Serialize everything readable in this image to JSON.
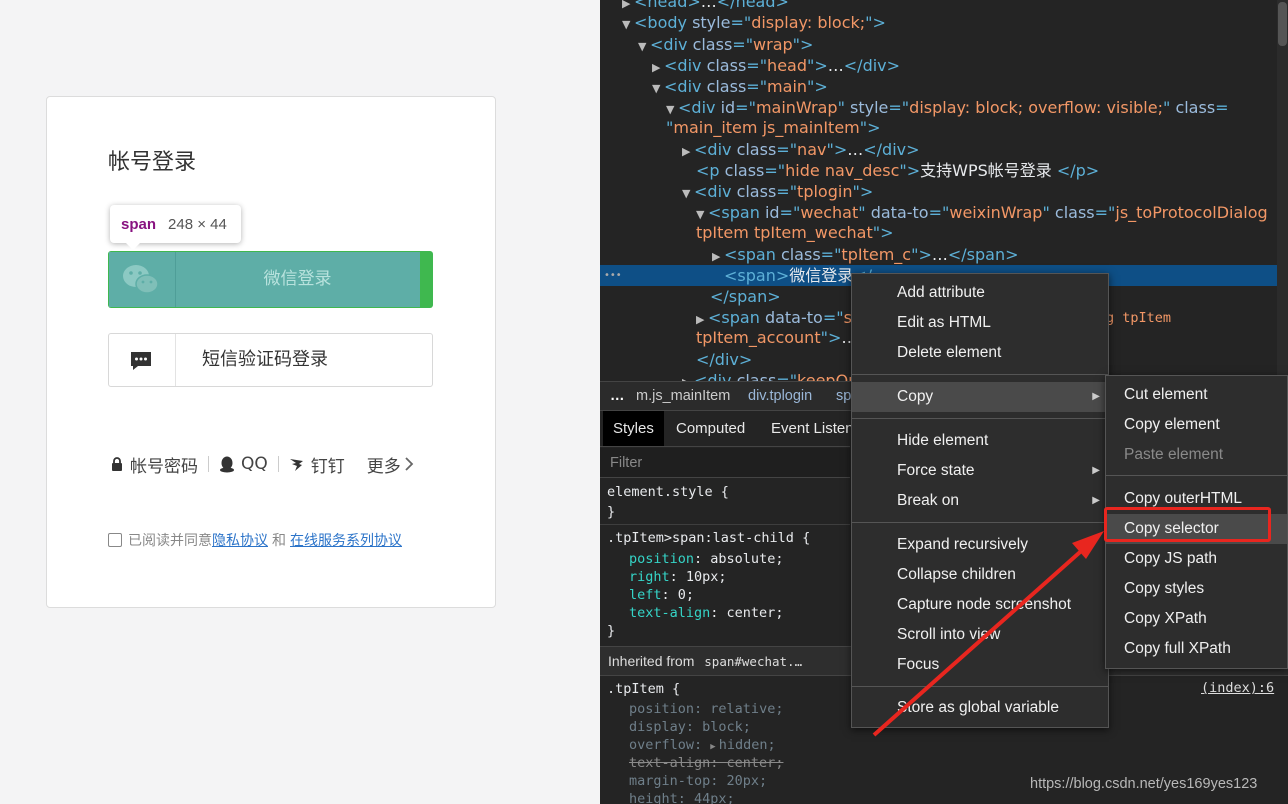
{
  "login": {
    "title": "帐号登录",
    "tooltip_tag": "span",
    "tooltip_size": "248 × 44",
    "wechat_label": "微信登录",
    "sms_label": "短信验证码登录",
    "alt_methods": [
      "帐号密码",
      "QQ",
      "钉钉",
      "更多"
    ],
    "agree_text": "已阅读并同意",
    "agree_privacy": "隐私协议",
    "agree_and": "和",
    "agree_service": "在线服务系列协议"
  },
  "elements": [
    {
      "tri": "▶",
      "parts": [
        [
          "tag",
          "<head>"
        ],
        [
          "txt",
          "…"
        ],
        [
          "tag",
          "</head>"
        ]
      ]
    },
    {
      "tri": "▼",
      "parts": [
        [
          "tag",
          "<body "
        ],
        [
          "attr",
          "style"
        ],
        [
          "tag",
          "=\""
        ],
        [
          "val",
          "display: block;"
        ],
        [
          "tag",
          "\">"
        ]
      ]
    },
    {
      "tri": "▼",
      "parts": [
        [
          "tag",
          "<div "
        ],
        [
          "attr",
          "class"
        ],
        [
          "tag",
          "=\""
        ],
        [
          "val",
          "wrap"
        ],
        [
          "tag",
          "\">"
        ]
      ]
    },
    {
      "tri": "▶",
      "parts": [
        [
          "tag",
          "<div "
        ],
        [
          "attr",
          "class"
        ],
        [
          "tag",
          "=\""
        ],
        [
          "val",
          "head"
        ],
        [
          "tag",
          "\">"
        ],
        [
          "txt",
          "…"
        ],
        [
          "tag",
          "</div>"
        ]
      ]
    },
    {
      "tri": "▼",
      "parts": [
        [
          "tag",
          "<div "
        ],
        [
          "attr",
          "class"
        ],
        [
          "tag",
          "=\""
        ],
        [
          "val",
          "main"
        ],
        [
          "tag",
          "\">"
        ]
      ]
    },
    {
      "tri": "▼",
      "parts": [
        [
          "tag",
          "<div "
        ],
        [
          "attr",
          "id"
        ],
        [
          "tag",
          "=\""
        ],
        [
          "val",
          "mainWrap"
        ],
        [
          "tag",
          "\" "
        ],
        [
          "attr",
          "style"
        ],
        [
          "tag",
          "=\""
        ],
        [
          "val",
          "display: block; overflow: visible;"
        ],
        [
          "tag",
          "\" "
        ],
        [
          "attr",
          "class"
        ],
        [
          "tag",
          "="
        ]
      ]
    },
    {
      "tri": "",
      "parts": [
        [
          "tag",
          "\""
        ],
        [
          "val",
          "main_item js_mainItem"
        ],
        [
          "tag",
          "\">"
        ]
      ]
    },
    {
      "tri": "▶",
      "parts": [
        [
          "tag",
          "<div "
        ],
        [
          "attr",
          "class"
        ],
        [
          "tag",
          "=\""
        ],
        [
          "val",
          "nav"
        ],
        [
          "tag",
          "\">"
        ],
        [
          "txt",
          "…"
        ],
        [
          "tag",
          "</div>"
        ]
      ]
    },
    {
      "tri": "",
      "parts": [
        [
          "tag",
          "<p "
        ],
        [
          "attr",
          "class"
        ],
        [
          "tag",
          "=\""
        ],
        [
          "val",
          "hide nav_desc"
        ],
        [
          "tag",
          "\">"
        ],
        [
          "txt",
          "支持WPS帐号登录 "
        ],
        [
          "tag",
          "</p>"
        ]
      ]
    },
    {
      "tri": "▼",
      "parts": [
        [
          "tag",
          "<div "
        ],
        [
          "attr",
          "class"
        ],
        [
          "tag",
          "=\""
        ],
        [
          "val",
          "tplogin"
        ],
        [
          "tag",
          "\">"
        ]
      ]
    },
    {
      "tri": "▼",
      "parts": [
        [
          "tag",
          "<span "
        ],
        [
          "attr",
          "id"
        ],
        [
          "tag",
          "=\""
        ],
        [
          "val",
          "wechat"
        ],
        [
          "tag",
          "\" "
        ],
        [
          "attr",
          "data-to"
        ],
        [
          "tag",
          "=\""
        ],
        [
          "val",
          "weixinWrap"
        ],
        [
          "tag",
          "\" "
        ],
        [
          "attr",
          "class"
        ],
        [
          "tag",
          "=\""
        ],
        [
          "val",
          "js_toProtocolDialog"
        ]
      ]
    },
    {
      "tri": "",
      "parts": [
        [
          "val",
          "tpItem tpItem_wechat"
        ],
        [
          "tag",
          "\">"
        ]
      ]
    },
    {
      "tri": "▶",
      "parts": [
        [
          "tag",
          "<span "
        ],
        [
          "attr",
          "class"
        ],
        [
          "tag",
          "=\""
        ],
        [
          "val",
          "tpItem_c"
        ],
        [
          "tag",
          "\">"
        ],
        [
          "txt",
          "…"
        ],
        [
          "tag",
          "</span>"
        ]
      ]
    },
    {
      "tri": "",
      "parts": [
        [
          "tag",
          "<span>"
        ],
        [
          "txt",
          "微信登录"
        ],
        [
          "tag",
          "</"
        ]
      ]
    },
    {
      "tri": "",
      "parts": [
        [
          "tag",
          "</span>"
        ]
      ]
    },
    {
      "tri": "▶",
      "parts": [
        [
          "tag",
          "<span "
        ],
        [
          "attr",
          "data-to"
        ],
        [
          "tag",
          "=\""
        ],
        [
          "val",
          "sm"
        ]
      ]
    },
    {
      "tri": "",
      "parts": [
        [
          "val",
          "tpItem_account"
        ],
        [
          "tag",
          "\">"
        ],
        [
          "txt",
          "…"
        ],
        [
          "tag",
          "</"
        ]
      ]
    },
    {
      "tri": "",
      "parts": [
        [
          "tag",
          "</div>"
        ]
      ]
    },
    {
      "tri": "▶",
      "parts": [
        [
          "tag",
          "<div "
        ],
        [
          "attr",
          "class"
        ],
        [
          "tag",
          "=\""
        ],
        [
          "val",
          "keepOnl"
        ]
      ]
    }
  ],
  "elements_tail": "g tpItem",
  "dots": "•••",
  "breadcrumbs": [
    "…",
    "m.js_mainItem",
    "div.tplogin",
    "sp"
  ],
  "tabs": [
    "Styles",
    "Computed",
    "Event Listen"
  ],
  "filter_placeholder": "Filter",
  "styles": {
    "element_style": "element.style {",
    "close": "}",
    "rule1_selector": ".tpItem>span:last-child {",
    "rule1_props": [
      [
        "position",
        "absolute;"
      ],
      [
        "right",
        "10px;"
      ],
      [
        "left",
        "0;"
      ],
      [
        "text-align",
        "center;"
      ]
    ],
    "inherited_label": "Inherited from",
    "inherited_node": "span#wechat.…",
    "rule2_selector": ".tpItem {",
    "rule2_source": "(index):6",
    "rule2_props": [
      [
        "position",
        "relative;"
      ],
      [
        "display",
        "block;"
      ],
      [
        "overflow",
        "hidden;"
      ],
      [
        "text-align",
        "center;"
      ],
      [
        "margin-top",
        "20px;"
      ],
      [
        "height",
        "44px;"
      ]
    ]
  },
  "context_menu": [
    "Add attribute",
    "Edit as HTML",
    "Delete element",
    "Copy",
    "Hide element",
    "Force state",
    "Break on",
    "Expand recursively",
    "Collapse children",
    "Capture node screenshot",
    "Scroll into view",
    "Focus",
    "Store as global variable"
  ],
  "copy_submenu": [
    "Cut element",
    "Copy element",
    "Paste element",
    "Copy outerHTML",
    "Copy selector",
    "Copy JS path",
    "Copy styles",
    "Copy XPath",
    "Copy full XPath"
  ],
  "watermark": "https://blog.csdn.net/yes169yes123",
  "colors": {
    "wechat_green": "#3fb84f",
    "highlight": "#5eaea7",
    "selection": "#0e4f86",
    "annotation_red": "#e8261f"
  }
}
